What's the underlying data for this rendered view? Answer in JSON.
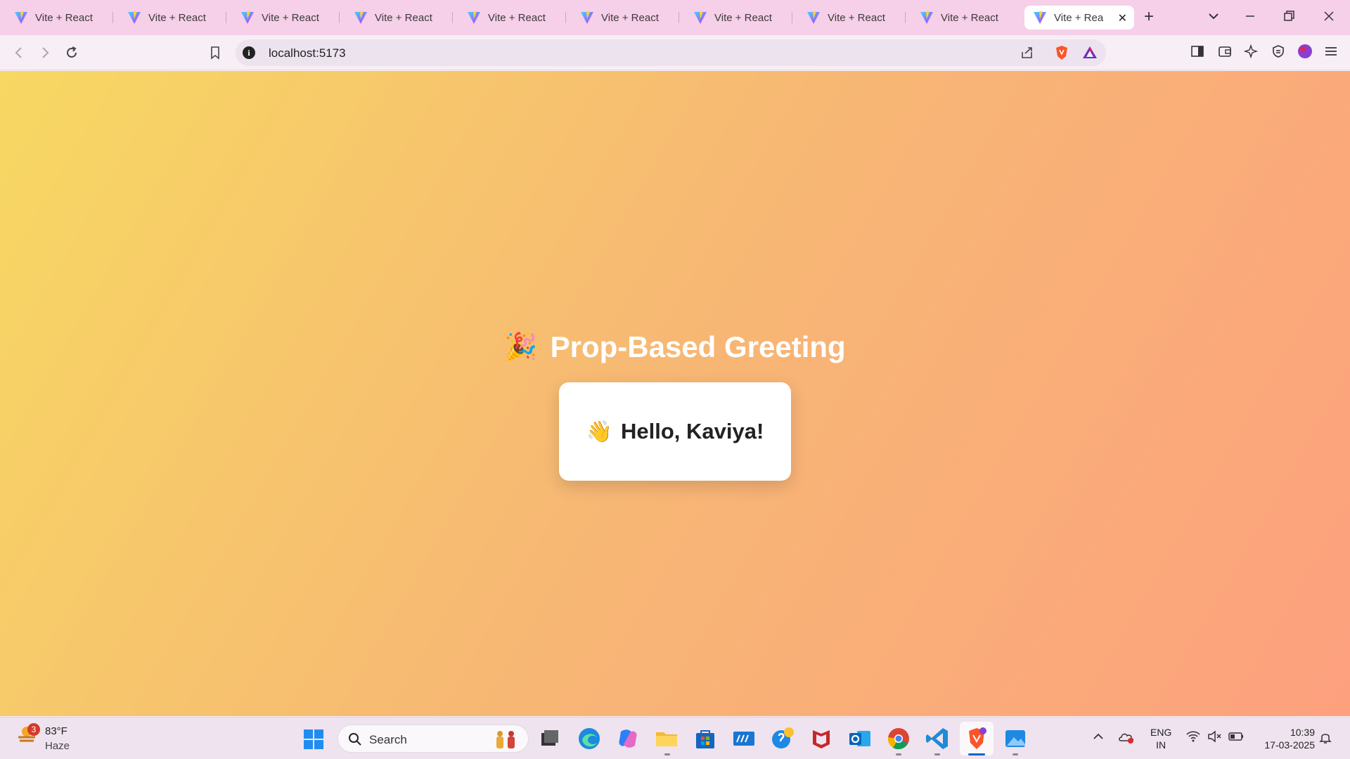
{
  "browser": {
    "tabs": [
      {
        "title": "Vite + React"
      },
      {
        "title": "Vite + React"
      },
      {
        "title": "Vite + React"
      },
      {
        "title": "Vite + React"
      },
      {
        "title": "Vite + React"
      },
      {
        "title": "Vite + React"
      },
      {
        "title": "Vite + React"
      },
      {
        "title": "Vite + React"
      },
      {
        "title": "Vite + React"
      },
      {
        "title": "Vite + Rea"
      }
    ],
    "url": "localhost:5173"
  },
  "page": {
    "heading": "Prop-Based Greeting",
    "heading_emoji": "🎉",
    "greeting": "Hello, Kaviya!",
    "greeting_emoji": "👋"
  },
  "taskbar": {
    "weather_temp": "83°F",
    "weather_desc": "Haze",
    "weather_badge": "3",
    "search_label": "Search",
    "lang_line1": "ENG",
    "lang_line2": "IN",
    "time": "10:39",
    "date": "17-03-2025"
  },
  "colors": {
    "gradient_start": "#f7d862",
    "gradient_end": "#fda07e",
    "tabstrip": "#f6cfe9"
  }
}
